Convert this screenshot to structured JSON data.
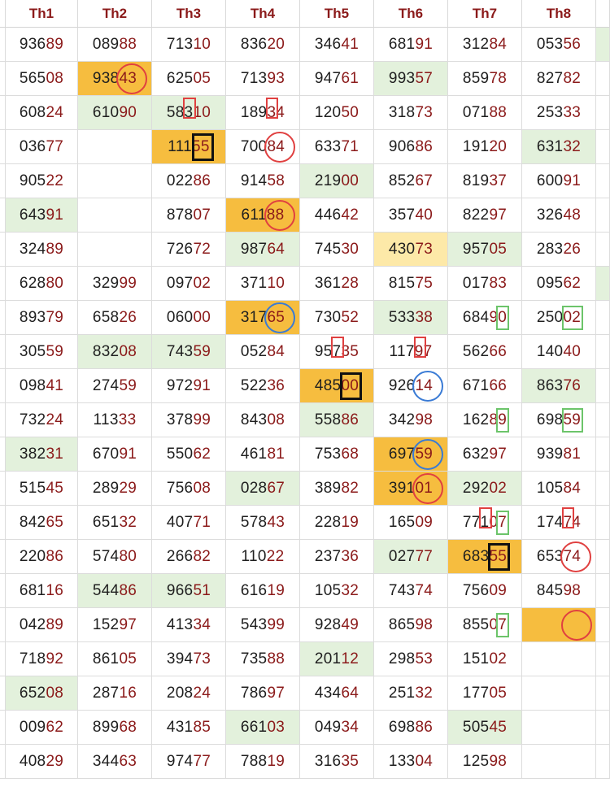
{
  "headers": [
    "Th1",
    "Th2",
    "Th3",
    "Th4",
    "Th5",
    "Th6",
    "Th7",
    "Th8"
  ],
  "rows": [
    [
      "93689",
      "08988",
      "71310",
      "83620",
      "34641",
      "68191",
      "31284",
      "05356"
    ],
    [
      "56508",
      "93843",
      "62505",
      "71393",
      "94761",
      "99357",
      "85978",
      "82782"
    ],
    [
      "60824",
      "61090",
      "58310",
      "18934",
      "12050",
      "31873",
      "07188",
      "25333"
    ],
    [
      "03677",
      "",
      "11155",
      "70084",
      "63371",
      "90686",
      "19120",
      "63132"
    ],
    [
      "90522",
      "",
      "02286",
      "91458",
      "21900",
      "85267",
      "81937",
      "60091"
    ],
    [
      "64391",
      "",
      "87807",
      "61188",
      "44642",
      "35740",
      "82297",
      "32648"
    ],
    [
      "32489",
      "",
      "72672",
      "98764",
      "74530",
      "43073",
      "95705",
      "28326"
    ],
    [
      "62880",
      "32999",
      "09702",
      "37110",
      "36128",
      "81575",
      "01783",
      "09562"
    ],
    [
      "89379",
      "65826",
      "06000",
      "31765",
      "73052",
      "53338",
      "68490",
      "25002"
    ],
    [
      "30559",
      "83208",
      "74359",
      "05284",
      "95735",
      "11797",
      "56266",
      "14040"
    ],
    [
      "09841",
      "27459",
      "97291",
      "52236",
      "48500",
      "92614",
      "67166",
      "86376"
    ],
    [
      "73224",
      "11333",
      "37899",
      "84308",
      "55886",
      "34298",
      "16289",
      "69859"
    ],
    [
      "38231",
      "67091",
      "55062",
      "46181",
      "75368",
      "69759",
      "63297",
      "93981"
    ],
    [
      "51545",
      "28929",
      "75608",
      "02867",
      "38982",
      "39101",
      "29202",
      "10584"
    ],
    [
      "84265",
      "65132",
      "40771",
      "57843",
      "22819",
      "16509",
      "77107",
      "17474"
    ],
    [
      "22086",
      "57480",
      "26682",
      "11022",
      "23736",
      "02777",
      "68355",
      "65374"
    ],
    [
      "68116",
      "54486",
      "96651",
      "61619",
      "10532",
      "74374",
      "75609",
      "84598"
    ],
    [
      "04289",
      "15297",
      "41334",
      "54399",
      "92849",
      "86598",
      "85507",
      ""
    ],
    [
      "71892",
      "86105",
      "39473",
      "73588",
      "20112",
      "29853",
      "15102",
      ""
    ],
    [
      "65208",
      "28716",
      "20824",
      "78697",
      "43464",
      "25132",
      "17705",
      ""
    ],
    [
      "00962",
      "89968",
      "43185",
      "66103",
      "04934",
      "69886",
      "50545",
      ""
    ],
    [
      "40829",
      "34463",
      "97477",
      "78819",
      "31635",
      "13304",
      "12598",
      ""
    ]
  ],
  "highlights": {
    "green": [
      [
        1,
        5
      ],
      [
        2,
        1
      ],
      [
        2,
        2
      ],
      [
        3,
        7
      ],
      [
        4,
        4
      ],
      [
        5,
        0
      ],
      [
        6,
        3
      ],
      [
        6,
        6
      ],
      [
        8,
        5
      ],
      [
        9,
        1
      ],
      [
        9,
        2
      ],
      [
        10,
        7
      ],
      [
        11,
        4
      ],
      [
        12,
        0
      ],
      [
        13,
        3
      ],
      [
        13,
        6
      ],
      [
        15,
        5
      ],
      [
        16,
        1
      ],
      [
        16,
        2
      ],
      [
        18,
        4
      ],
      [
        19,
        0
      ],
      [
        20,
        3
      ],
      [
        20,
        6
      ]
    ],
    "orange": [
      [
        1,
        1
      ],
      [
        3,
        2
      ],
      [
        5,
        3
      ],
      [
        8,
        3
      ],
      [
        10,
        4
      ],
      [
        12,
        5
      ],
      [
        13,
        5
      ],
      [
        15,
        6
      ],
      [
        17,
        7
      ]
    ],
    "yellow": [
      [
        6,
        5
      ]
    ]
  },
  "colors": {
    "header_text": "#8b1a1a",
    "number_prefix": "#1f1f1f",
    "number_suffix": "#8b1a1a",
    "green_fill": "#e3f1dc",
    "orange_fill": "#f6bd3f",
    "yellow_fill": "#fde9a8",
    "red_mark": "#e04040",
    "blue_mark": "#3a7bd5",
    "green_mark": "#6cc46a",
    "black_mark": "#111111"
  },
  "annotations": [
    {
      "kind": "circle",
      "color": "red",
      "row": 1,
      "col": 1
    },
    {
      "kind": "box",
      "color": "red",
      "row": 2,
      "col": 2
    },
    {
      "kind": "box",
      "color": "red",
      "row": 2,
      "col": 3
    },
    {
      "kind": "box",
      "color": "black",
      "row": 3,
      "col": 2
    },
    {
      "kind": "circle",
      "color": "red",
      "row": 3,
      "col": 3
    },
    {
      "kind": "circle",
      "color": "red",
      "row": 5,
      "col": 3
    },
    {
      "kind": "circle",
      "color": "blue",
      "row": 8,
      "col": 3
    },
    {
      "kind": "box",
      "color": "green",
      "row": 8,
      "col": 6
    },
    {
      "kind": "box",
      "color": "green",
      "row": 8,
      "col": 7
    },
    {
      "kind": "box",
      "color": "red",
      "row": 9,
      "col": 4
    },
    {
      "kind": "box",
      "color": "red",
      "row": 9,
      "col": 5
    },
    {
      "kind": "box",
      "color": "black",
      "row": 10,
      "col": 4
    },
    {
      "kind": "circle",
      "color": "blue",
      "row": 10,
      "col": 5
    },
    {
      "kind": "box",
      "color": "green",
      "row": 11,
      "col": 6
    },
    {
      "kind": "box",
      "color": "green",
      "row": 11,
      "col": 7
    },
    {
      "kind": "circle",
      "color": "blue",
      "row": 12,
      "col": 5
    },
    {
      "kind": "circle",
      "color": "red",
      "row": 13,
      "col": 5
    },
    {
      "kind": "box",
      "color": "red",
      "row": 14,
      "col": 6
    },
    {
      "kind": "box",
      "color": "green",
      "row": 14,
      "col": 6
    },
    {
      "kind": "box",
      "color": "red",
      "row": 14,
      "col": 7
    },
    {
      "kind": "box",
      "color": "black",
      "row": 15,
      "col": 6
    },
    {
      "kind": "circle",
      "color": "red",
      "row": 15,
      "col": 7
    },
    {
      "kind": "box",
      "color": "green",
      "row": 17,
      "col": 6
    },
    {
      "kind": "circle",
      "color": "red",
      "row": 17,
      "col": 7
    }
  ]
}
